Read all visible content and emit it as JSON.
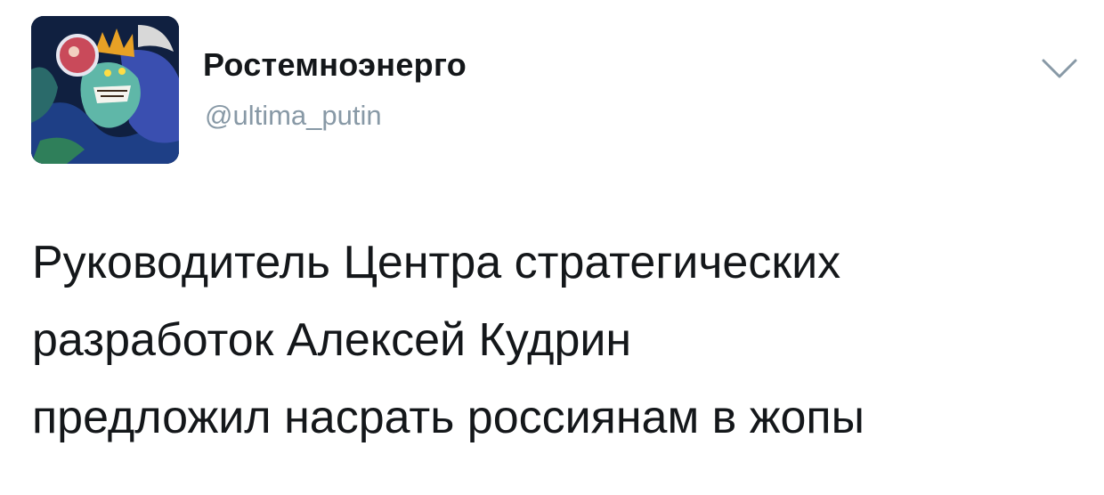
{
  "author": {
    "display_name": "Ростемноэнерго",
    "handle": "@ultima_putin",
    "avatar_icon": "illustrated-avatar"
  },
  "menu": {
    "icon": "chevron-down-icon"
  },
  "tweet": {
    "lines": [
      "Руководитель Центра стратегических",
      "разработок Алексей Кудрин",
      "предложил насрать россиянам в жопы"
    ]
  },
  "colors": {
    "text": "#14171a",
    "secondary": "#8899a6",
    "background": "#ffffff"
  }
}
